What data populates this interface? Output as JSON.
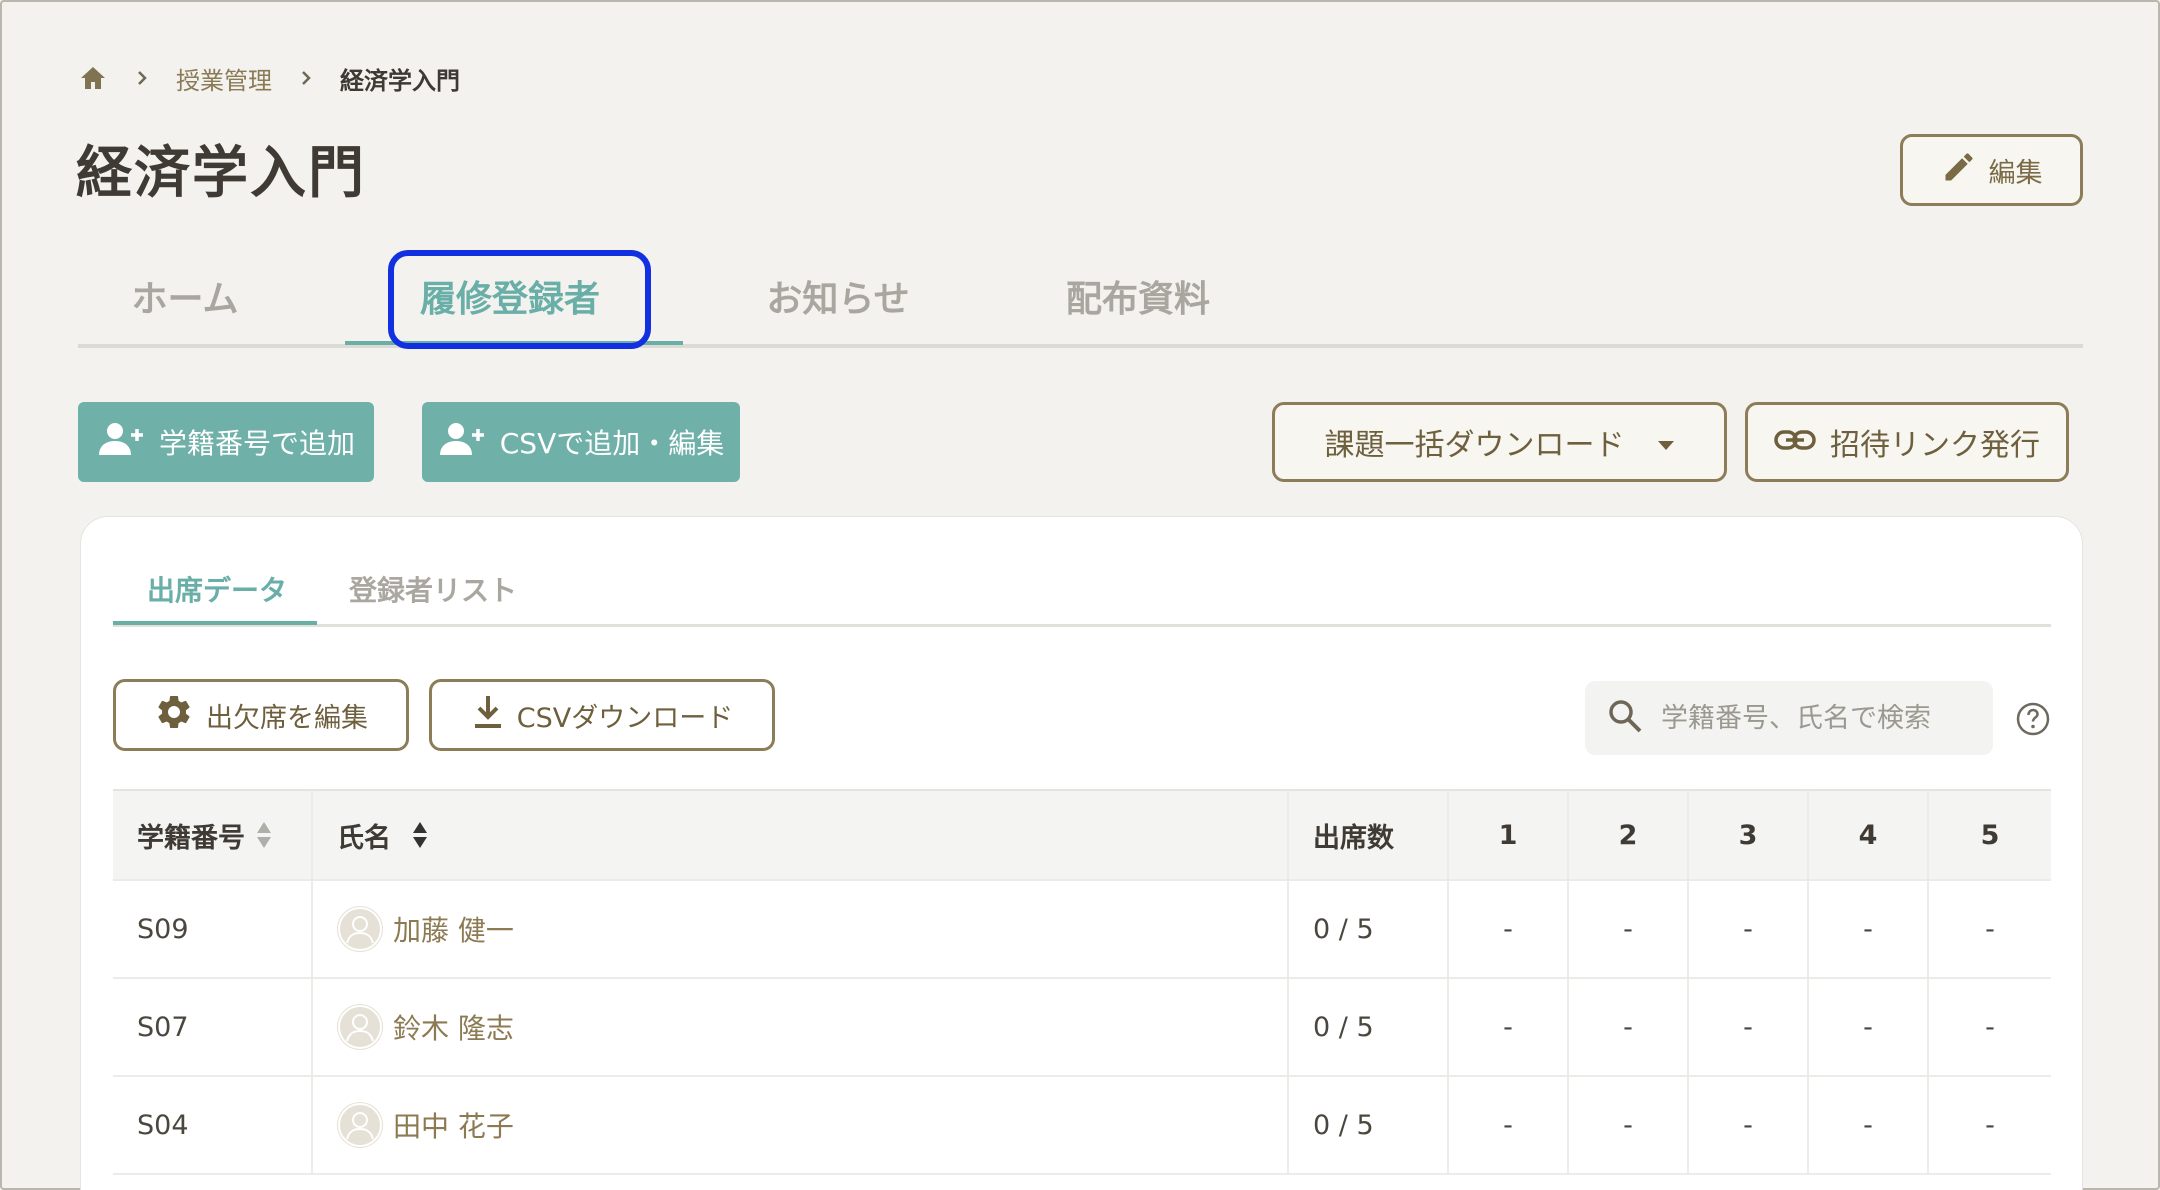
{
  "breadcrumb": {
    "home_icon": "home-icon",
    "items": [
      "授業管理",
      "経済学入門"
    ]
  },
  "page": {
    "title": "経済学入門",
    "edit_label": "編集"
  },
  "main_tabs": [
    {
      "label": "ホーム",
      "active": false
    },
    {
      "label": "履修登録者",
      "active": true
    },
    {
      "label": "お知らせ",
      "active": false
    },
    {
      "label": "配布資料",
      "active": false
    }
  ],
  "actions": {
    "add_by_id": "学籍番号で追加",
    "add_by_csv": "CSVで追加・編集",
    "bulk_download": "課題一括ダウンロード",
    "invite_link": "招待リンク発行"
  },
  "sub_tabs": [
    {
      "label": "出席データ",
      "active": true
    },
    {
      "label": "登録者リスト",
      "active": false
    }
  ],
  "toolbar": {
    "edit_attendance": "出欠席を編集",
    "csv_download": "CSVダウンロード",
    "search_placeholder": "学籍番号、氏名で検索"
  },
  "table": {
    "headers": {
      "student_id": "学籍番号",
      "name": "氏名",
      "attendance": "出席数",
      "sessions": [
        "1",
        "2",
        "3",
        "4",
        "5"
      ]
    },
    "rows": [
      {
        "student_id": "S09",
        "name": "加藤 健一",
        "attendance": "0 / 5",
        "sessions": [
          "-",
          "-",
          "-",
          "-",
          "-"
        ]
      },
      {
        "student_id": "S07",
        "name": "鈴木 隆志",
        "attendance": "0 / 5",
        "sessions": [
          "-",
          "-",
          "-",
          "-",
          "-"
        ]
      },
      {
        "student_id": "S04",
        "name": "田中 花子",
        "attendance": "0 / 5",
        "sessions": [
          "-",
          "-",
          "-",
          "-",
          "-"
        ]
      }
    ]
  },
  "colors": {
    "accent_teal": "#6fb0a9",
    "accent_brown": "#8c7c57",
    "focus_blue": "#1131e0",
    "background": "#f3f2ee"
  }
}
